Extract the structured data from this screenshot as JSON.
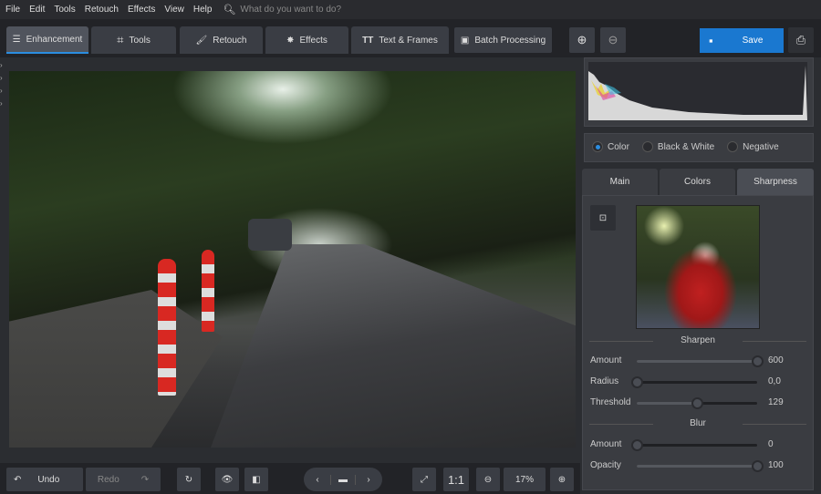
{
  "menu": {
    "items": [
      "File",
      "Edit",
      "Tools",
      "Retouch",
      "Effects",
      "View",
      "Help"
    ],
    "search_placeholder": "What do you want to do?"
  },
  "tabs": [
    {
      "label": "Enhancement",
      "icon": "sliders-icon"
    },
    {
      "label": "Tools",
      "icon": "crop-icon"
    },
    {
      "label": "Retouch",
      "icon": "brush-icon"
    },
    {
      "label": "Effects",
      "icon": "magic-wand-icon"
    },
    {
      "label": "Text & Frames",
      "icon": "text-icon"
    },
    {
      "label": "Batch Processing",
      "icon": "images-icon"
    }
  ],
  "save_label": "Save",
  "bottom": {
    "undo": "Undo",
    "redo": "Redo",
    "one_to_one": "1:1",
    "zoom": "17%"
  },
  "color_mode": {
    "options": [
      "Color",
      "Black & White",
      "Negative"
    ],
    "selected": "Color"
  },
  "subtabs": {
    "items": [
      "Main",
      "Colors",
      "Sharpness"
    ],
    "active": "Sharpness"
  },
  "sharpen": {
    "title": "Sharpen",
    "sliders": [
      {
        "label": "Amount",
        "value": "600",
        "fraction": 1.0
      },
      {
        "label": "Radius",
        "value": "0,0",
        "fraction": 0.0
      },
      {
        "label": "Threshold",
        "value": "129",
        "fraction": 0.5
      }
    ]
  },
  "blur": {
    "title": "Blur",
    "sliders": [
      {
        "label": "Amount",
        "value": "0",
        "fraction": 0.0
      },
      {
        "label": "Opacity",
        "value": "100",
        "fraction": 1.0
      }
    ]
  },
  "colors": {
    "accent": "#2b8de0",
    "save": "#1a78d0"
  }
}
